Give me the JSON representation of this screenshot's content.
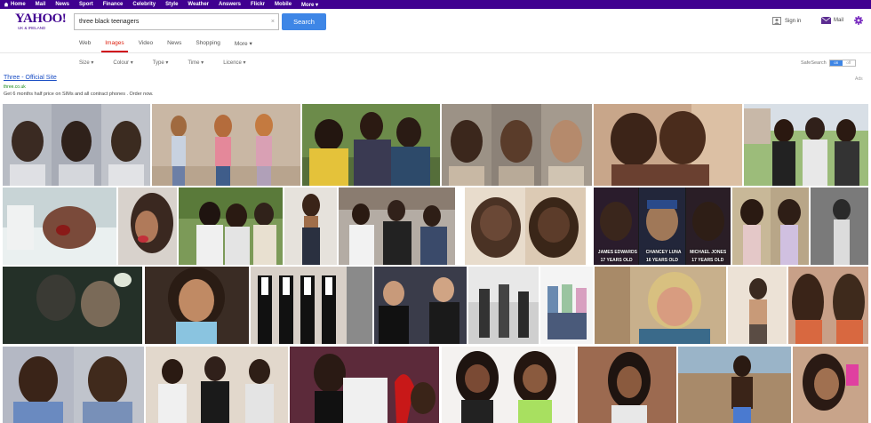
{
  "topnav": {
    "items": [
      "Home",
      "Mail",
      "News",
      "Sport",
      "Finance",
      "Celebrity",
      "Style",
      "Weather",
      "Answers",
      "Flickr",
      "Mobile",
      "More ▾"
    ]
  },
  "header": {
    "logo_word": "YAHOO!",
    "logo_sub": "UK & IRELAND",
    "search_value": "three black teenagers",
    "search_clear": "×",
    "search_button": "Search",
    "signin_label": "Sign in",
    "mail_label": "Mail"
  },
  "verticals": {
    "tabs": [
      "Web",
      "Images",
      "Video",
      "News",
      "Shopping",
      "More ▾"
    ],
    "active": "Images"
  },
  "filters": {
    "items": [
      "Size ▾",
      "Colour ▾",
      "Type ▾",
      "Time ▾",
      "Licence ▾"
    ],
    "safesearch_label": "SafeSearch",
    "toggle_on": "on",
    "toggle_off": "off"
  },
  "ad": {
    "title": "Three - Official Site",
    "url": "three.co.uk",
    "description": "Get 6 months half price on SIMs and all contract phones . Order now.",
    "label": "Ads"
  },
  "mugshot_caption": {
    "names": [
      "JAMES EDWARDS",
      "CHANCEY LUNA",
      "MICHAEL JONES"
    ],
    "ages": [
      "17 YEARS OLD",
      "16 YEARS OLD",
      "17 YEARS OLD"
    ]
  },
  "colors": {
    "brand_purple": "#400090",
    "search_blue": "#3e86e6",
    "active_tab_red": "#d0021b",
    "ad_link_blue": "#1a4ec4",
    "ad_url_green": "#1a8a1a"
  },
  "icons": [
    "home-icon",
    "person-icon",
    "mail-icon",
    "gear-icon"
  ]
}
